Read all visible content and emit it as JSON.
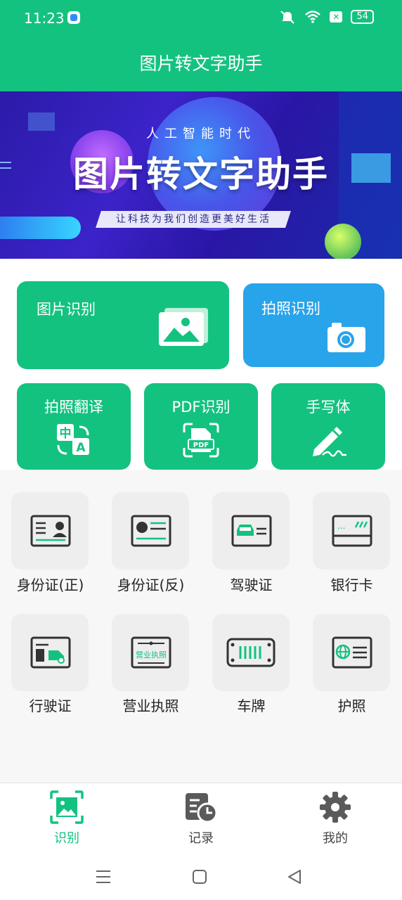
{
  "status_bar": {
    "time": "11:23",
    "battery": "54"
  },
  "header": {
    "title": "图片转文字助手"
  },
  "banner": {
    "subtitle": "人工智能时代",
    "title": "图片转文字助手",
    "slogan": "让科技为我们创造更美好生活"
  },
  "main_actions": [
    {
      "label": "图片识别",
      "color": "#14c280",
      "icon": "image-icon"
    },
    {
      "label": "拍照识别",
      "color": "#28a4ea",
      "icon": "camera-icon"
    }
  ],
  "secondary_actions": [
    {
      "label": "拍照翻译",
      "icon": "translate-icon"
    },
    {
      "label": "PDF识别",
      "icon": "pdf-scan-icon"
    },
    {
      "label": "手写体",
      "icon": "handwriting-icon"
    }
  ],
  "doc_types": [
    {
      "label": "身份证(正)",
      "icon": "id-card-front-icon"
    },
    {
      "label": "身份证(反)",
      "icon": "id-card-back-icon"
    },
    {
      "label": "驾驶证",
      "icon": "driver-license-icon"
    },
    {
      "label": "银行卡",
      "icon": "bank-card-icon"
    },
    {
      "label": "行驶证",
      "icon": "vehicle-license-icon"
    },
    {
      "label": "营业执照",
      "icon": "business-license-icon"
    },
    {
      "label": "车牌",
      "icon": "license-plate-icon"
    },
    {
      "label": "护照",
      "icon": "passport-icon"
    }
  ],
  "business_license_icon_text": "营业执照",
  "bottom_nav": [
    {
      "label": "识别",
      "icon": "scan-image-icon",
      "active": true
    },
    {
      "label": "记录",
      "icon": "history-icon",
      "active": false
    },
    {
      "label": "我的",
      "icon": "gear-icon",
      "active": false
    }
  ],
  "colors": {
    "primary": "#14c280",
    "blue": "#28a4ea",
    "icon_dark": "#333333"
  }
}
